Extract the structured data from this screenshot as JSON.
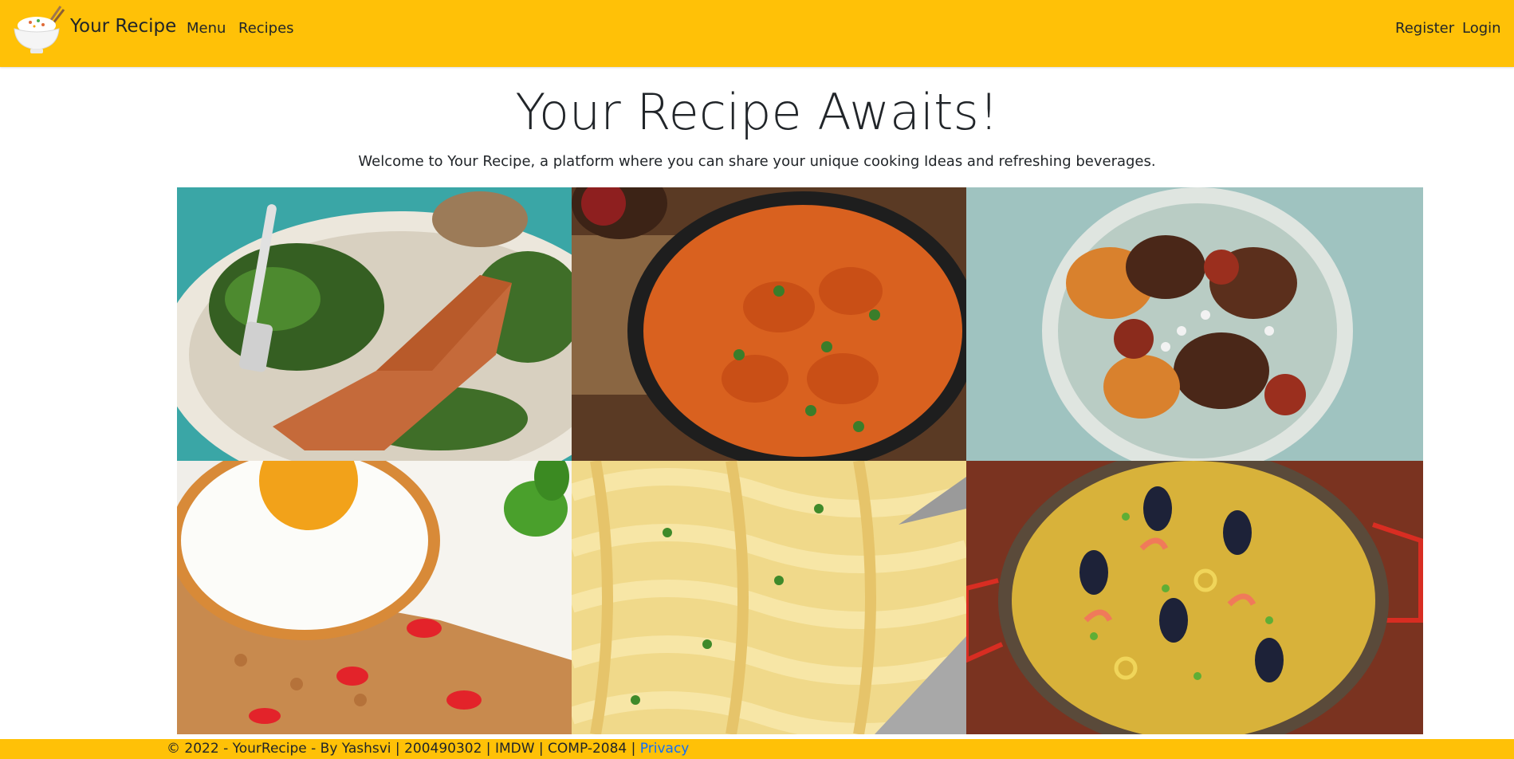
{
  "header": {
    "brand": "Your Recipe",
    "nav_left": [
      "Menu",
      "Recipes"
    ],
    "nav_right": [
      "Register",
      "Login"
    ],
    "background": "#ffc107"
  },
  "hero": {
    "title": "Your Recipe Awaits!",
    "subtitle": "Welcome to Your Recipe, a platform where you can share your unique cooking Ideas and refreshing beverages."
  },
  "footer": {
    "text": "© 2022 - YourRecipe - By Yashsvi | 200490302 | IMDW | COMP-2084 | ",
    "link": "Privacy"
  },
  "gallery": [
    "salmon-salad-photo",
    "butter-chicken-photo",
    "roast-chicken-plate-photo",
    "fried-egg-rice-photo",
    "fettuccine-alfredo-photo",
    "seafood-paella-photo"
  ]
}
